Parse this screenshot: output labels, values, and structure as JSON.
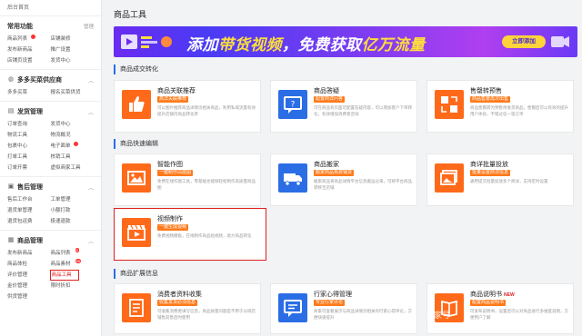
{
  "sidebar": {
    "home": "后台首页",
    "sections": [
      {
        "title": "常用功能",
        "extra": "管理",
        "items": [
          "商品列表",
          "店铺装修",
          "发布新商品",
          "推广设置",
          "店铺页设置",
          "发货中心"
        ]
      },
      {
        "title": "多多买菜供应商",
        "items": [
          "多多买菜",
          "报名买菜供货"
        ]
      },
      {
        "title": "发货管理",
        "items": [
          "订单查询",
          "发货中心",
          "物流工具",
          "物流概况",
          "包裹中心",
          "电子面单",
          "打单工具",
          "核销工具",
          "订单开票",
          "虚拟商家工具"
        ]
      },
      {
        "title": "售后管理",
        "items": [
          "售后工作台",
          "工单管理",
          "退货单管理",
          "小额打款",
          "退货包运费",
          "极速退款"
        ]
      },
      {
        "title": "商品管理",
        "items": [
          "发布新商品",
          "商品列表",
          "商品体检",
          "商品素材",
          "评价管理",
          "商品工具",
          "金价管理",
          "限时折扣",
          "供货管理"
        ]
      }
    ],
    "badges": {
      "product_list_num": "29",
      "material_num": "99",
      "goods_list_num": "8"
    }
  },
  "main": {
    "title": "商品工具",
    "banner": {
      "text_a": "添加",
      "text_b": "带货视频",
      "text_c": "，免费获取",
      "text_d": "亿万流量",
      "button": "立即添加"
    },
    "sections": [
      {
        "title": "商品成交转化"
      },
      {
        "title": "商品快速编辑"
      },
      {
        "title": "商品扩展信息"
      }
    ],
    "cards": [
      {
        "name": "商品关联推荐",
        "tag": "高详关联推荐",
        "desc": "可以图片推荐商品详情页相关商品，利用私域流量有效提升店铺内商品转化率",
        "color": "#ff6a1a"
      },
      {
        "name": "商品答疑",
        "tag": "配置商详问答",
        "desc": "可在商品有页面可配置答疑内容，可以增加客户下单转化，有效增加消费者咨询",
        "color": "#2b6de5"
      },
      {
        "name": "售罄转预售",
        "tag": "商品售罄再次出售",
        "desc": "商品售罄转为预售待发货商品，售罄后可以有效的提升用户体验，不错过任一笔订单",
        "color": "#ff6a1a"
      },
      {
        "name": "智能作图",
        "tag": "一键制作白底图",
        "desc": "免费在线作图工具，零基础也能够轻松制作高质量商品图",
        "color": "#ff6a1a"
      },
      {
        "name": "商品搬家",
        "tag": "搬家商品免费铺货",
        "desc": "搬家商品将商品详情平台信息搬运过来，可将平台商品转移至店铺",
        "color": "#2b6de5"
      },
      {
        "name": "商详批量投放",
        "tag": "批量设置商详信息",
        "desc": "通用提交批量投放多个商详，支持定时设置",
        "color": "#ff6a1a"
      },
      {
        "name": "视频制作",
        "tag": "一键生成视频",
        "desc": "免费视频模板，在线制作商品短视频，助力商品转化",
        "color": "#ff6a1a"
      },
      {
        "name": "消费者资料收集",
        "tag": "收集发货必须信息",
        "desc": "可收集消费者填写信息，商品质量问题是不用于分辨店铺售前售后时使用",
        "color": "#ff6a1a"
      },
      {
        "name": "行家心得管理",
        "tag": "专业行家评论",
        "desc": "商家可查看展示与商品详情页相关的行家心得评论，方便快速提升",
        "color": "#2b6de5"
      },
      {
        "name": "商品说明书",
        "new": "NEW",
        "tag": "配置商品说明书",
        "desc": "可发布说明书，设置后可以对商品进行多维度说明，方便用户了解",
        "color": "#ff6a1a"
      }
    ]
  },
  "watermark": "百家号"
}
